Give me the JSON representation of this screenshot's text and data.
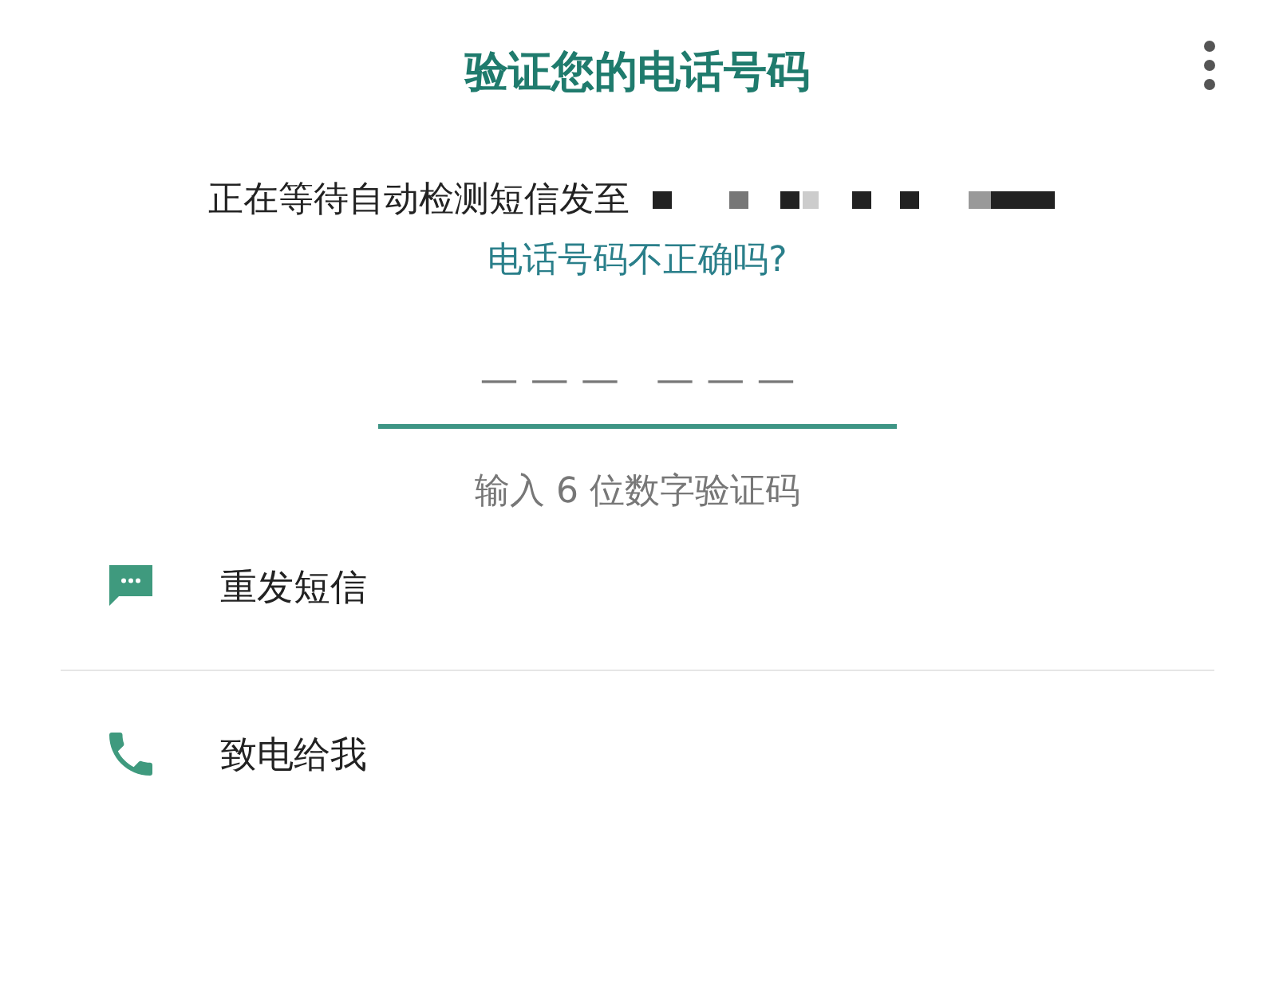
{
  "title": "验证您的电话号码",
  "message": {
    "text": "正在等待自动检测短信发至",
    "link": "电话号码不正确吗?"
  },
  "code_field": {
    "placeholder": "— — —   — — —"
  },
  "hint": "输入 6 位数字验证码",
  "options": [
    {
      "kind": "sms",
      "label": "重发短信"
    },
    {
      "kind": "call",
      "label": "致电给我"
    }
  ]
}
